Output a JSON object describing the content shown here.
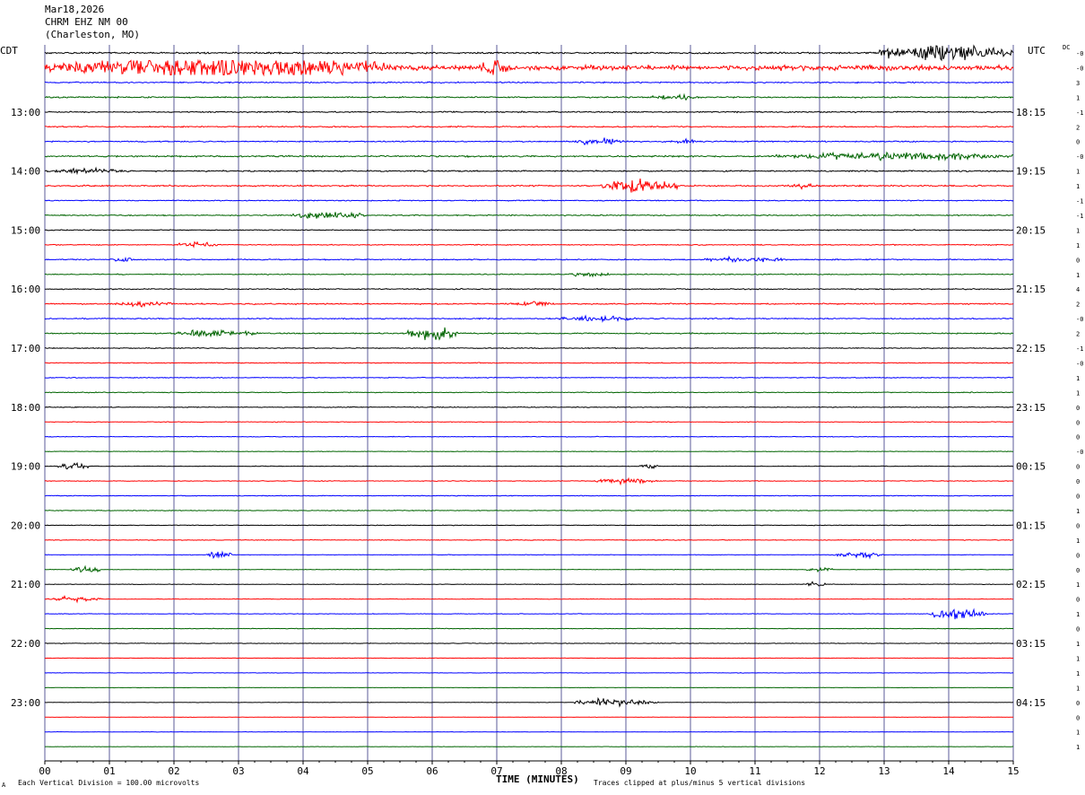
{
  "header": {
    "date": "Mar18,2026",
    "station": "CHRM EHZ NM 00",
    "location": "(Charleston, MO)"
  },
  "left_timezone": "CDT",
  "right_timezone": "UTC",
  "dc_label": "DC",
  "footer": {
    "scale_note": "Each Vertical Division =  100.00 microvolts",
    "xaxis_title": "TIME (MINUTES)",
    "clip_note": "Traces clipped at plus/minus 5 vertical divisions",
    "corner_mark": "A"
  },
  "colors": {
    "trace_cycle": [
      "#000000",
      "#ff0000",
      "#0000ff",
      "#006400"
    ],
    "grid": "#5b5b9a",
    "axis": "#000000"
  },
  "chart_data": {
    "type": "line",
    "title": "CHRM EHZ NM 00",
    "xlabel": "TIME (MINUTES)",
    "ylabel": "",
    "x_ticks": [
      "00",
      "01",
      "02",
      "03",
      "04",
      "05",
      "06",
      "07",
      "08",
      "09",
      "10",
      "11",
      "12",
      "13",
      "14",
      "15"
    ],
    "xlim": [
      0,
      15
    ],
    "n_traces": 48,
    "left_hour_labels": [
      "13:00",
      "14:00",
      "15:00",
      "16:00",
      "17:00",
      "18:00",
      "19:00",
      "20:00",
      "21:00",
      "22:00",
      "23:00"
    ],
    "right_hour_labels": [
      "18:15",
      "19:15",
      "20:15",
      "21:15",
      "22:15",
      "23:15",
      "00:15",
      "01:15",
      "02:15",
      "03:15",
      "04:15"
    ],
    "dc_offsets": [
      "-0",
      "-0",
      "3",
      "1",
      "-1",
      "2",
      "0",
      "-0",
      "1",
      "1",
      "-1",
      "-1",
      "1",
      "1",
      "0",
      "1",
      "4",
      "2",
      "-0",
      "2",
      "-1",
      "-0",
      "1",
      "1",
      "0",
      "0",
      "0",
      "-0",
      "0",
      "0",
      "0",
      "1",
      "0",
      "1",
      "0",
      "0",
      "1",
      "0",
      "1",
      "0",
      "1",
      "1",
      "1",
      "1",
      "0",
      "0",
      "1",
      "1"
    ],
    "amplitude": [
      0.6,
      1.8,
      0.45,
      0.5,
      0.45,
      0.45,
      0.45,
      0.55,
      0.5,
      0.5,
      0.35,
      0.4,
      0.35,
      0.35,
      0.4,
      0.35,
      0.4,
      0.45,
      0.4,
      0.45,
      0.3,
      0.3,
      0.3,
      0.3,
      0.3,
      0.25,
      0.25,
      0.2,
      0.2,
      0.25,
      0.25,
      0.25,
      0.25,
      0.25,
      0.2,
      0.2,
      0.2,
      0.2,
      0.2,
      0.2,
      0.2,
      0.15,
      0.15,
      0.15,
      0.15,
      0.15,
      0.15,
      0.15
    ],
    "events": [
      {
        "trace": 0,
        "start": 12.9,
        "end": 15.0,
        "amp": 7
      },
      {
        "trace": 1,
        "start": 0.0,
        "end": 5.4,
        "amp": 9
      },
      {
        "trace": 1,
        "start": 6.7,
        "end": 7.2,
        "amp": 6
      },
      {
        "trace": 3,
        "start": 9.3,
        "end": 10.2,
        "amp": 2
      },
      {
        "trace": 6,
        "start": 8.2,
        "end": 9.0,
        "amp": 3
      },
      {
        "trace": 6,
        "start": 9.8,
        "end": 10.1,
        "amp": 3
      },
      {
        "trace": 7,
        "start": 11.3,
        "end": 15.0,
        "amp": 3
      },
      {
        "trace": 8,
        "start": 0.0,
        "end": 1.3,
        "amp": 2
      },
      {
        "trace": 9,
        "start": 8.6,
        "end": 9.8,
        "amp": 6
      },
      {
        "trace": 9,
        "start": 11.5,
        "end": 12.0,
        "amp": 2
      },
      {
        "trace": 11,
        "start": 3.8,
        "end": 5.0,
        "amp": 3
      },
      {
        "trace": 13,
        "start": 2.0,
        "end": 2.7,
        "amp": 2
      },
      {
        "trace": 14,
        "start": 1.0,
        "end": 1.4,
        "amp": 2
      },
      {
        "trace": 14,
        "start": 10.2,
        "end": 11.5,
        "amp": 2
      },
      {
        "trace": 15,
        "start": 8.1,
        "end": 8.8,
        "amp": 2
      },
      {
        "trace": 17,
        "start": 1.0,
        "end": 2.0,
        "amp": 2
      },
      {
        "trace": 17,
        "start": 7.2,
        "end": 7.9,
        "amp": 2
      },
      {
        "trace": 18,
        "start": 7.8,
        "end": 9.2,
        "amp": 2
      },
      {
        "trace": 19,
        "start": 2.0,
        "end": 3.3,
        "amp": 3
      },
      {
        "trace": 19,
        "start": 5.6,
        "end": 6.4,
        "amp": 5
      },
      {
        "trace": 28,
        "start": 0.2,
        "end": 0.7,
        "amp": 3
      },
      {
        "trace": 28,
        "start": 9.2,
        "end": 9.5,
        "amp": 2
      },
      {
        "trace": 29,
        "start": 8.5,
        "end": 9.5,
        "amp": 2
      },
      {
        "trace": 34,
        "start": 2.5,
        "end": 2.9,
        "amp": 3
      },
      {
        "trace": 34,
        "start": 12.2,
        "end": 13.0,
        "amp": 2
      },
      {
        "trace": 35,
        "start": 0.4,
        "end": 0.9,
        "amp": 3
      },
      {
        "trace": 35,
        "start": 11.8,
        "end": 12.2,
        "amp": 2
      },
      {
        "trace": 36,
        "start": 11.8,
        "end": 12.1,
        "amp": 2
      },
      {
        "trace": 37,
        "start": 0.0,
        "end": 0.9,
        "amp": 2
      },
      {
        "trace": 38,
        "start": 13.7,
        "end": 14.6,
        "amp": 4
      },
      {
        "trace": 44,
        "start": 8.2,
        "end": 9.5,
        "amp": 3
      }
    ],
    "grid": true
  }
}
